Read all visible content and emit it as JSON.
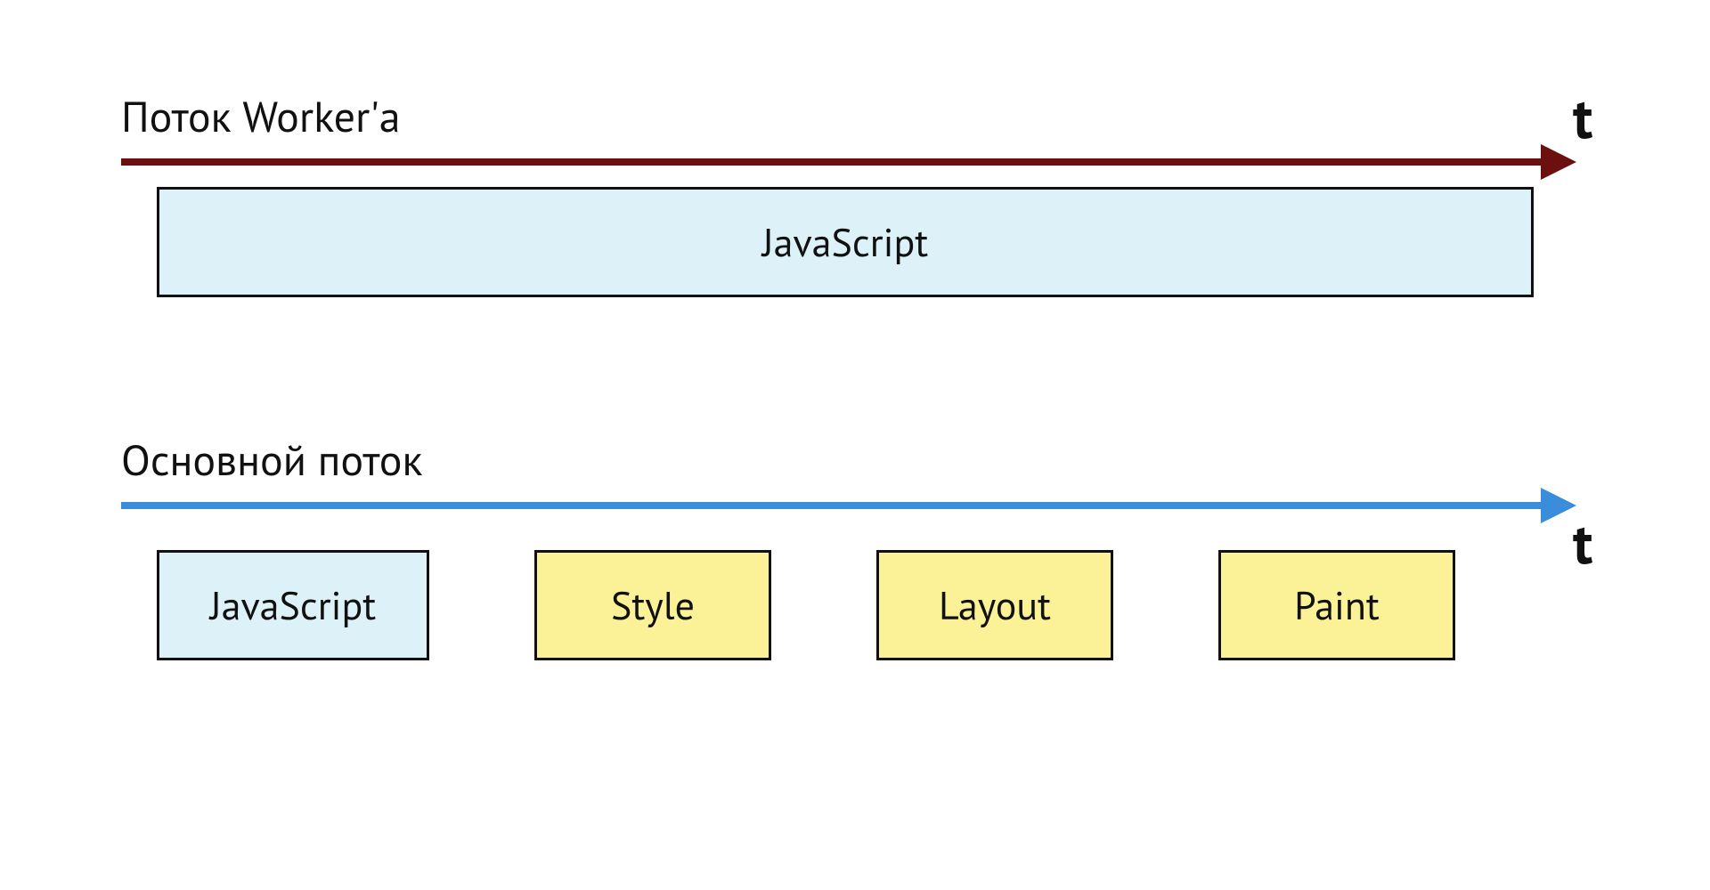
{
  "colors": {
    "worker_arrow": "#6b0f0f",
    "main_arrow": "#3a8ddb",
    "js_fill": "#ddf1f8",
    "stage_fill": "#fbf196"
  },
  "worker": {
    "title": "Поток Worker'а",
    "time_label": "t",
    "block": "JavaScript"
  },
  "main": {
    "title": "Основной поток",
    "time_label": "t",
    "blocks": [
      "JavaScript",
      "Style",
      "Layout",
      "Paint"
    ]
  }
}
